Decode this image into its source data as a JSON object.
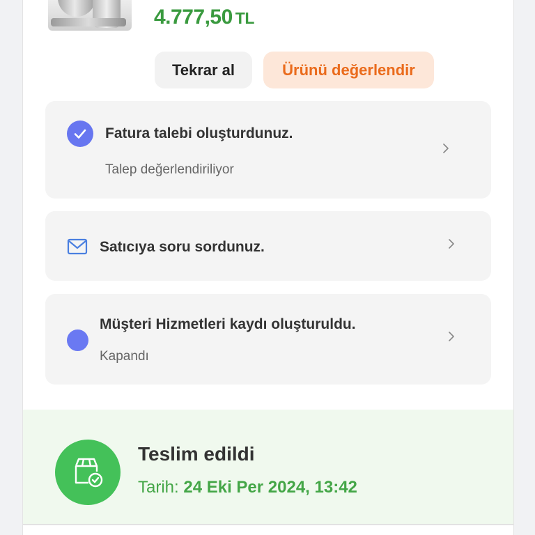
{
  "product": {
    "image_alt": "stand mixer",
    "price_amount": "4.777,50",
    "price_currency": "TL"
  },
  "actions": {
    "rebuy_label": "Tekrar al",
    "review_label": "Ürünü değerlendir"
  },
  "cards": [
    {
      "title": "Fatura talebi oluşturdunuz.",
      "subtitle": "Talep değerlendiriliyor",
      "icon": "check-circle-icon"
    },
    {
      "title": "Satıcıya soru sordunuz.",
      "icon": "mail-icon"
    },
    {
      "title": "Müşteri Hizmetleri kaydı oluşturuldu.",
      "subtitle": "Kapandı",
      "icon": "status-dot-icon"
    }
  ],
  "delivery": {
    "title": "Teslim edildi",
    "date_label": "Tarih:",
    "date_value": "24 Eki Per 2024, 13:42",
    "icon": "package-check-icon"
  },
  "colors": {
    "price_green": "#3a9a3f",
    "review_orange": "#ea6b1c",
    "review_bg": "#fde7d9",
    "accent_blue": "#6776f0",
    "delivered_green": "#44c159",
    "delivered_bg": "#f0f9ee"
  }
}
